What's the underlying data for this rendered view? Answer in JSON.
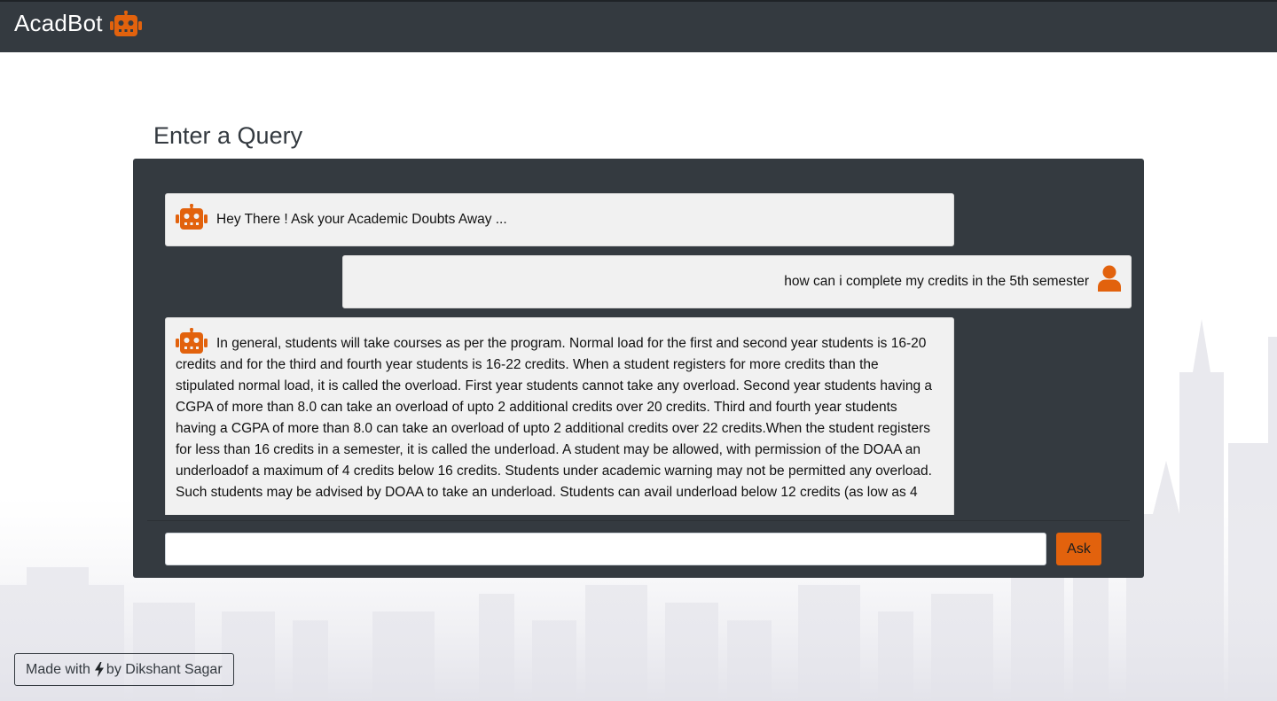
{
  "app": {
    "title": "AcadBot",
    "logo_icon": "robot-icon",
    "accent_color": "#e2620d",
    "navbar_color": "#343a40"
  },
  "main": {
    "heading": "Enter a Query"
  },
  "chat": {
    "messages": [
      {
        "sender": "bot",
        "avatar_icon": "robot-icon",
        "text": "Hey There ! Ask your Academic Doubts Away ..."
      },
      {
        "sender": "user",
        "avatar_icon": "user-icon",
        "text": "how can i complete my credits in the 5th semester"
      },
      {
        "sender": "bot",
        "avatar_icon": "robot-icon",
        "text": "In general, students will take courses as per the program. Normal load for the first and second year students is 16-20 credits and for the third and fourth year students is 16-22 credits. When a student registers for more credits than the stipulated normal load, it is called the overload. First year students cannot take any overload. Second year students having a CGPA of more than 8.0 can take an overload of upto 2 additional credits over 20 credits. Third and fourth year students having a CGPA of more than 8.0 can take an overload of upto 2 additional credits over 22 credits.When the student registers for less than 16 credits in a semester, it is called the underload. A student may be allowed, with permission of the DOAA an underloadof a maximum of 4 credits below 16 credits. Students under academic warning may not be permitted any overload. Such students may be advised by DOAA to take an underload. Students can avail underload below 12 credits (as low as 4"
      }
    ]
  },
  "input": {
    "value": "",
    "ask_label": "Ask"
  },
  "footer": {
    "made_with": "Made with",
    "bolt_icon": "bolt-icon",
    "by": "by Dikshant Sagar"
  }
}
